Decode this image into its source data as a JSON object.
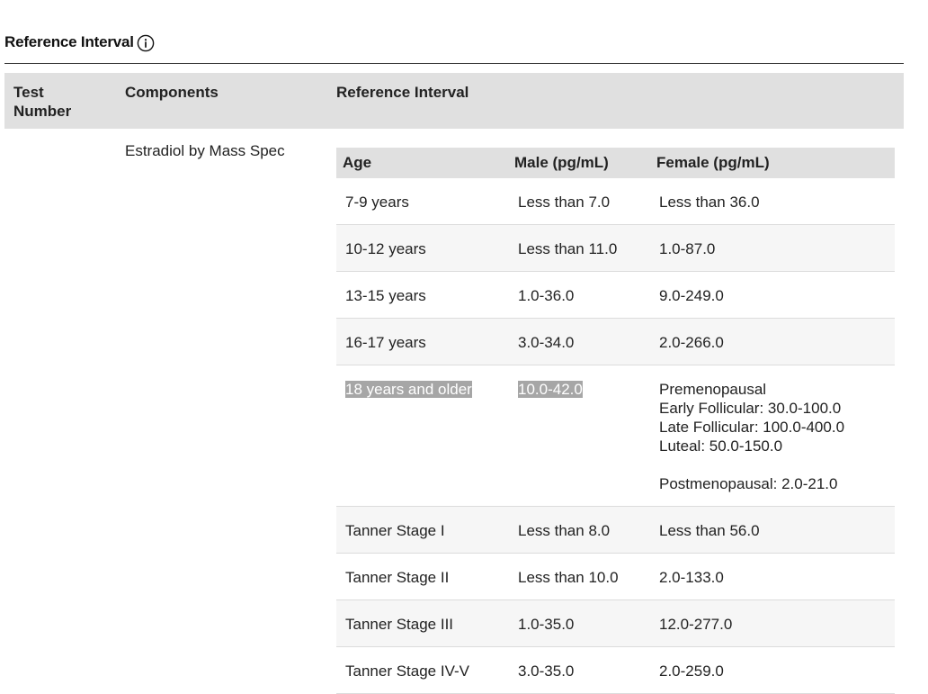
{
  "section": {
    "title": "Reference Interval"
  },
  "outer_table": {
    "headers": {
      "test_number": "Test Number",
      "components": "Components",
      "reference_interval": "Reference Interval"
    },
    "component_name": "Estradiol by Mass Spec"
  },
  "inner_table": {
    "headers": {
      "age": "Age",
      "male": "Male (pg/mL)",
      "female": "Female (pg/mL)"
    },
    "rows": [
      {
        "age": "7-9 years",
        "male": "Less than 7.0",
        "female": "Less than 36.0"
      },
      {
        "age": "10-12 years",
        "male": "Less than 11.0",
        "female": "1.0-87.0"
      },
      {
        "age": "13-15 years",
        "male": "1.0-36.0",
        "female": "9.0-249.0"
      },
      {
        "age": "16-17 years",
        "male": "3.0-34.0",
        "female": "2.0-266.0"
      },
      {
        "age": "18 years and older",
        "male": "10.0-42.0",
        "female_lines": [
          "Premenopausal",
          "Early Follicular: 30.0-100.0",
          "Late Follicular: 100.0-400.0",
          "Luteal: 50.0-150.0",
          "",
          "Postmenopausal: 2.0-21.0"
        ]
      },
      {
        "age": "Tanner Stage I",
        "male": "Less than 8.0",
        "female": "Less than 56.0"
      },
      {
        "age": "Tanner Stage II",
        "male": "Less than 10.0",
        "female": "2.0-133.0"
      },
      {
        "age": "Tanner Stage III",
        "male": "1.0-35.0",
        "female": "12.0-277.0"
      },
      {
        "age": "Tanner Stage IV-V",
        "male": "3.0-35.0",
        "female": "2.0-259.0"
      }
    ]
  },
  "colors": {
    "header_bg": "#e0e0e0",
    "alt_row_bg": "#f6f6f6",
    "selection_bg": "#a6a6a6",
    "rule": "#333333"
  },
  "icons": {
    "info": "info-circle-icon"
  }
}
